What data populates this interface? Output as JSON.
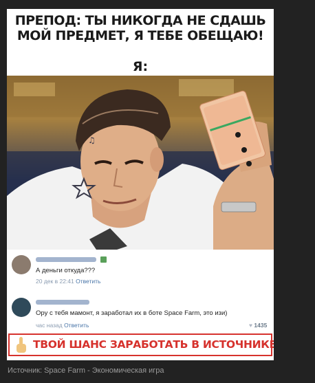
{
  "meme": {
    "top_line1": "ПРЕПОД: ТЫ НИКОГДА НЕ СДАШЬ",
    "top_line2": "МОЙ ПРЕДМЕТ, Я ТЕБЕ ОБЕЩАЮ!",
    "ya": "Я:"
  },
  "comments": [
    {
      "text": "А деньги откуда???",
      "date": "20 дек в 22:41",
      "reply": "Ответить"
    },
    {
      "text": "Ору с тебя мамонт, я заработал их в боте Space Farm, это изи)",
      "date": "час назад",
      "reply": "Ответить",
      "likes": "1435"
    }
  ],
  "banner": {
    "text": "ТВОЙ ШАНС ЗАРАБОТАТЬ В ИСТОЧНИКЕ!"
  },
  "caption": {
    "text": "Источник: Space Farm - Экономическая игра"
  },
  "colors": {
    "banner_red": "#d6322d",
    "background": "#222222",
    "link_blue": "#4a76a8"
  },
  "icons": [
    "pointing-finger-icon",
    "heart-icon",
    "gift-icon"
  ]
}
